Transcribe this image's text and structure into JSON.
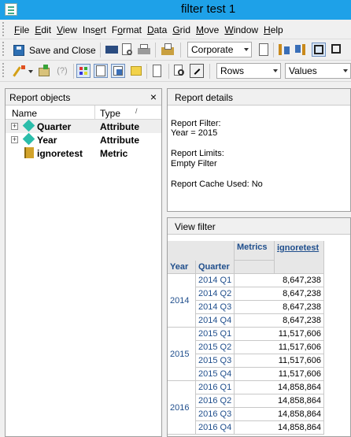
{
  "window": {
    "title": "filter test 1"
  },
  "menu": [
    {
      "prefix": "",
      "u": "F",
      "rest": "ile"
    },
    {
      "prefix": "",
      "u": "E",
      "rest": "dit"
    },
    {
      "prefix": "",
      "u": "V",
      "rest": "iew"
    },
    {
      "prefix": "Ins",
      "u": "e",
      "rest": "rt"
    },
    {
      "prefix": "F",
      "u": "o",
      "rest": "rmat"
    },
    {
      "prefix": "",
      "u": "D",
      "rest": "ata"
    },
    {
      "prefix": "",
      "u": "G",
      "rest": "rid"
    },
    {
      "prefix": "",
      "u": "M",
      "rest": "ove"
    },
    {
      "prefix": "",
      "u": "W",
      "rest": "indow"
    },
    {
      "prefix": "",
      "u": "H",
      "rest": "elp"
    }
  ],
  "toolbar": {
    "save_close_label": "Save and Close",
    "template_select": "Corporate",
    "rows_select": "Rows",
    "values_select": "Values"
  },
  "report_objects": {
    "title": "Report objects",
    "close_glyph": "×",
    "col_name": "Name",
    "col_type": "Type",
    "sort_glyph": "/",
    "items": [
      {
        "name": "Quarter",
        "type": "Attribute",
        "expander": "+"
      },
      {
        "name": "Year",
        "type": "Attribute",
        "expander": "+"
      },
      {
        "name": "ignoretest",
        "type": "Metric",
        "expander": ""
      }
    ]
  },
  "report_details": {
    "title": "Report details",
    "filter_label": "Report Filter:",
    "filter_value": "Year = 2015",
    "limits_label": "Report Limits:",
    "limits_value": "Empty Filter",
    "cache_line": "Report Cache Used: No"
  },
  "view_filter": {
    "title": "View filter",
    "header_metrics": "Metrics",
    "header_year": "Year",
    "header_quarter": "Quarter",
    "header_metric": "ignoretest",
    "groups": [
      {
        "year": "2014",
        "rows": [
          {
            "quarter": "2014 Q1",
            "value": "8,647,238"
          },
          {
            "quarter": "2014 Q2",
            "value": "8,647,238"
          },
          {
            "quarter": "2014 Q3",
            "value": "8,647,238"
          },
          {
            "quarter": "2014 Q4",
            "value": "8,647,238"
          }
        ]
      },
      {
        "year": "2015",
        "rows": [
          {
            "quarter": "2015 Q1",
            "value": "11,517,606"
          },
          {
            "quarter": "2015 Q2",
            "value": "11,517,606"
          },
          {
            "quarter": "2015 Q3",
            "value": "11,517,606"
          },
          {
            "quarter": "2015 Q4",
            "value": "11,517,606"
          }
        ]
      },
      {
        "year": "2016",
        "rows": [
          {
            "quarter": "2016 Q1",
            "value": "14,858,864"
          },
          {
            "quarter": "2016 Q2",
            "value": "14,858,864"
          },
          {
            "quarter": "2016 Q3",
            "value": "14,858,864"
          },
          {
            "quarter": "2016 Q4",
            "value": "14,858,864"
          }
        ]
      }
    ]
  },
  "colors": {
    "titlebar": "#1ea1e8",
    "grid_header_text": "#1f4e8c",
    "attribute_icon": "#2bbdaa",
    "metric_icon": "#d2a32a"
  }
}
